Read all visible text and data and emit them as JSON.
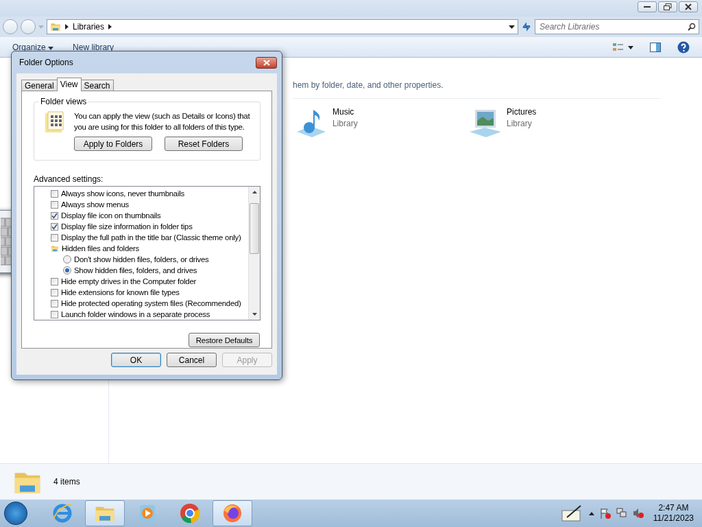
{
  "explorer": {
    "breadcrumb": [
      "Libraries"
    ],
    "search_placeholder": "Search Libraries",
    "toolbar": [
      {
        "label": "Organize",
        "kind": "menu"
      },
      {
        "label": "New library",
        "kind": "plain"
      }
    ],
    "description": "hem by folder, date, and other properties.",
    "libraries": [
      {
        "name": "Music",
        "type": "Library",
        "kind": "music"
      },
      {
        "name": "Pictures",
        "type": "Library",
        "kind": "pictures"
      }
    ],
    "status": "4 items"
  },
  "dialog": {
    "title": "Folder Options",
    "tabs": [
      {
        "label": "General",
        "selected": false
      },
      {
        "label": "View",
        "selected": true
      },
      {
        "label": "Search",
        "selected": false
      }
    ],
    "folder_views": {
      "legend": "Folder views",
      "text": "You can apply the view (such as Details or Icons) that you are using for this folder to all folders of this type.",
      "buttons": [
        "Apply to Folders",
        "Reset Folders"
      ]
    },
    "advanced_label": "Advanced settings:",
    "settings": [
      {
        "kind": "checkbox",
        "label": "Always show icons, never thumbnails",
        "checked": false
      },
      {
        "kind": "checkbox",
        "label": "Always show menus",
        "checked": false
      },
      {
        "kind": "checkbox",
        "label": "Display file icon on thumbnails",
        "checked": true
      },
      {
        "kind": "checkbox",
        "label": "Display file size information in folder tips",
        "checked": true
      },
      {
        "kind": "checkbox",
        "label": "Display the full path in the title bar (Classic theme only)",
        "checked": false
      },
      {
        "kind": "folder",
        "label": "Hidden files and folders",
        "children": [
          {
            "kind": "radio",
            "label": "Don't show hidden files, folders, or drives",
            "selected": false
          },
          {
            "kind": "radio",
            "label": "Show hidden files, folders, and drives",
            "selected": true
          }
        ]
      },
      {
        "kind": "checkbox",
        "label": "Hide empty drives in the Computer folder",
        "checked": false
      },
      {
        "kind": "checkbox",
        "label": "Hide extensions for known file types",
        "checked": false
      },
      {
        "kind": "checkbox",
        "label": "Hide protected operating system files (Recommended)",
        "checked": false
      },
      {
        "kind": "checkbox",
        "label": "Launch folder windows in a separate process",
        "checked": false
      }
    ],
    "restore_button": "Restore Defaults",
    "buttons": [
      {
        "label": "OK",
        "default": true,
        "disabled": false
      },
      {
        "label": "Cancel",
        "default": false,
        "disabled": false
      },
      {
        "label": "Apply",
        "default": false,
        "disabled": true
      }
    ]
  },
  "taskbar": {
    "apps": [
      {
        "kind": "ie",
        "active": false
      },
      {
        "kind": "explorer",
        "active": true
      },
      {
        "kind": "player",
        "active": false
      },
      {
        "kind": "chrome",
        "active": false
      },
      {
        "kind": "firefox",
        "active": true
      }
    ],
    "time": "2:47 AM",
    "date": "11/21/2023"
  }
}
